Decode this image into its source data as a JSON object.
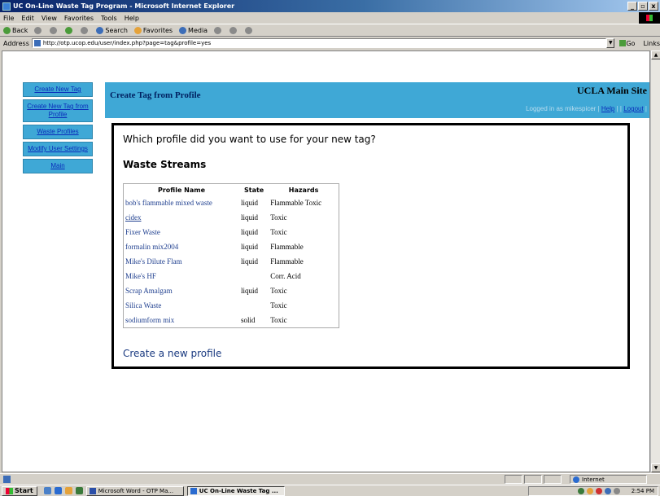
{
  "window": {
    "title": "UC On-Line Waste Tag Program - Microsoft Internet Explorer",
    "minimize": "_",
    "maximize": "▫",
    "close": "x"
  },
  "menu": [
    "File",
    "Edit",
    "View",
    "Favorites",
    "Tools",
    "Help"
  ],
  "toolbar": {
    "back": "Back",
    "search": "Search",
    "favorites": "Favorites",
    "media": "Media"
  },
  "address": {
    "label": "Address",
    "url": "http://otp.ucop.edu/user/index.php?page=tag&profile=yes",
    "go": "Go",
    "links": "Links"
  },
  "sidebar": {
    "items": [
      {
        "label": "Create New Tag"
      },
      {
        "label": "Create New Tag from Profile"
      },
      {
        "label": "Waste Profiles"
      },
      {
        "label": "Modify User Settings"
      },
      {
        "label": "Main"
      }
    ]
  },
  "header": {
    "title": "Create Tag from Profile",
    "site": "UCLA Main Site",
    "logged_in": "Logged in as mikespicer",
    "separator": "|",
    "help": "Help",
    "logout": "Logout"
  },
  "content": {
    "question": "Which profile did you want to use for your new tag?",
    "section_title": "Waste Streams",
    "columns": [
      "Profile Name",
      "State",
      "Hazards"
    ],
    "rows": [
      {
        "name": "bob's flammable mixed waste",
        "state": "liquid",
        "hazards": "Flammable Toxic"
      },
      {
        "name": "cidex",
        "state": "liquid",
        "hazards": "Toxic"
      },
      {
        "name": "Fixer Waste",
        "state": "liquid",
        "hazards": "Toxic"
      },
      {
        "name": "formalin mix2004",
        "state": "liquid",
        "hazards": "Flammable"
      },
      {
        "name": "Mike's Dilute Flam",
        "state": "liquid",
        "hazards": "Flammable"
      },
      {
        "name": "Mike's HF",
        "state": "",
        "hazards": "Corr. Acid"
      },
      {
        "name": "Scrap Amalgam",
        "state": "liquid",
        "hazards": "Toxic"
      },
      {
        "name": "Silica Waste",
        "state": "",
        "hazards": "Toxic"
      },
      {
        "name": "sodiumform mix",
        "state": "solid",
        "hazards": "Toxic"
      }
    ],
    "new_profile": "Create a new profile"
  },
  "statusbar": {
    "zone": "Internet"
  },
  "taskbar": {
    "start": "Start",
    "tasks": [
      "Microsoft Word - OTP Ma...",
      "UC On-Line Waste Tag ..."
    ],
    "clock": "2:54 PM"
  },
  "colors": {
    "accent": "#3fa8d6",
    "link": "#0a2cba",
    "title_bar": "#0a246a"
  }
}
